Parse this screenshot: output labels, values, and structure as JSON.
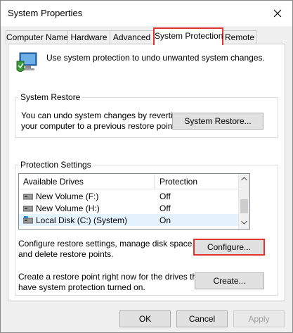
{
  "window": {
    "title": "System Properties"
  },
  "tabs": [
    {
      "label": "Computer Name",
      "active": false
    },
    {
      "label": "Hardware",
      "active": false
    },
    {
      "label": "Advanced",
      "active": false
    },
    {
      "label": "System Protection",
      "active": true
    },
    {
      "label": "Remote",
      "active": false
    }
  ],
  "header": {
    "text": "Use system protection to undo unwanted system changes."
  },
  "system_restore": {
    "label": "System Restore",
    "description_line1": "You can undo system changes by reverting",
    "description_line2": "your computer to a previous restore point.",
    "button": "System Restore..."
  },
  "protection_settings": {
    "label": "Protection Settings",
    "columns": {
      "drives": "Available Drives",
      "protection": "Protection"
    },
    "drives": [
      {
        "name": "New Volume (F:)",
        "protection": "Off",
        "icon": "hard-drive-icon",
        "selected": false
      },
      {
        "name": "New Volume (H:)",
        "protection": "Off",
        "icon": "hard-drive-icon",
        "selected": false
      },
      {
        "name": "Local Disk (C:) (System)",
        "protection": "On",
        "icon": "system-drive-icon",
        "selected": true
      }
    ],
    "configure_text_line1": "Configure restore settings, manage disk space,",
    "configure_text_line2": "and delete restore points.",
    "configure_button": "Configure...",
    "create_text_line1": "Create a restore point right now for the drives that",
    "create_text_line2": "have system protection turned on.",
    "create_button": "Create..."
  },
  "footer": {
    "ok": "OK",
    "cancel": "Cancel",
    "apply": "Apply"
  },
  "colors": {
    "highlight": "#e0332e",
    "selection": "#e5f3ff"
  }
}
